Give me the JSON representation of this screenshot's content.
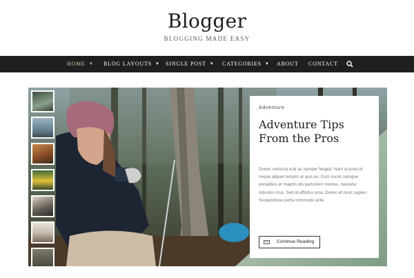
{
  "site": {
    "title": "Blogger",
    "tagline": "BLOGGING MADE EASY"
  },
  "nav": {
    "items": [
      {
        "label": "HOME",
        "has_dropdown": true,
        "active": true
      },
      {
        "label": "BLOG LAYOUTS",
        "has_dropdown": true,
        "active": false
      },
      {
        "label": "SINGLE POST",
        "has_dropdown": true,
        "active": false
      },
      {
        "label": "CATEGORIES",
        "has_dropdown": true,
        "active": false
      },
      {
        "label": "ABOUT",
        "has_dropdown": false,
        "active": false
      },
      {
        "label": "CONTACT",
        "has_dropdown": false,
        "active": false
      }
    ],
    "search_icon": "search-icon",
    "dropdown_icon": "chevron-down-icon"
  },
  "featured": {
    "category": "Adventure",
    "title": "Adventure Tips From the Pros",
    "excerpt": "Donec vehicula erat ac semper feugiat. Nam ut justo et neque aliquet tempor at quis ex. Cum sociis natoque penatibus et magnis dis parturient montes, nascetur ridiculus mus. Sed id efficitur urna. Donec et nunc sapien. Suspendisse porta commodo ante.",
    "button_label": "Continue Reading",
    "button_icon": "comment-icon"
  },
  "thumbnails": [
    {
      "name": "forest-trail"
    },
    {
      "name": "misty-lake"
    },
    {
      "name": "autumn-hiker"
    },
    {
      "name": "yellow-jacket"
    },
    {
      "name": "camera-gear"
    },
    {
      "name": "white-tshirt"
    },
    {
      "name": "extra"
    }
  ],
  "colors": {
    "nav_bg": "#1f1f1f",
    "nav_active": "#d8c9a4",
    "text_dark": "#1d1d1d"
  }
}
